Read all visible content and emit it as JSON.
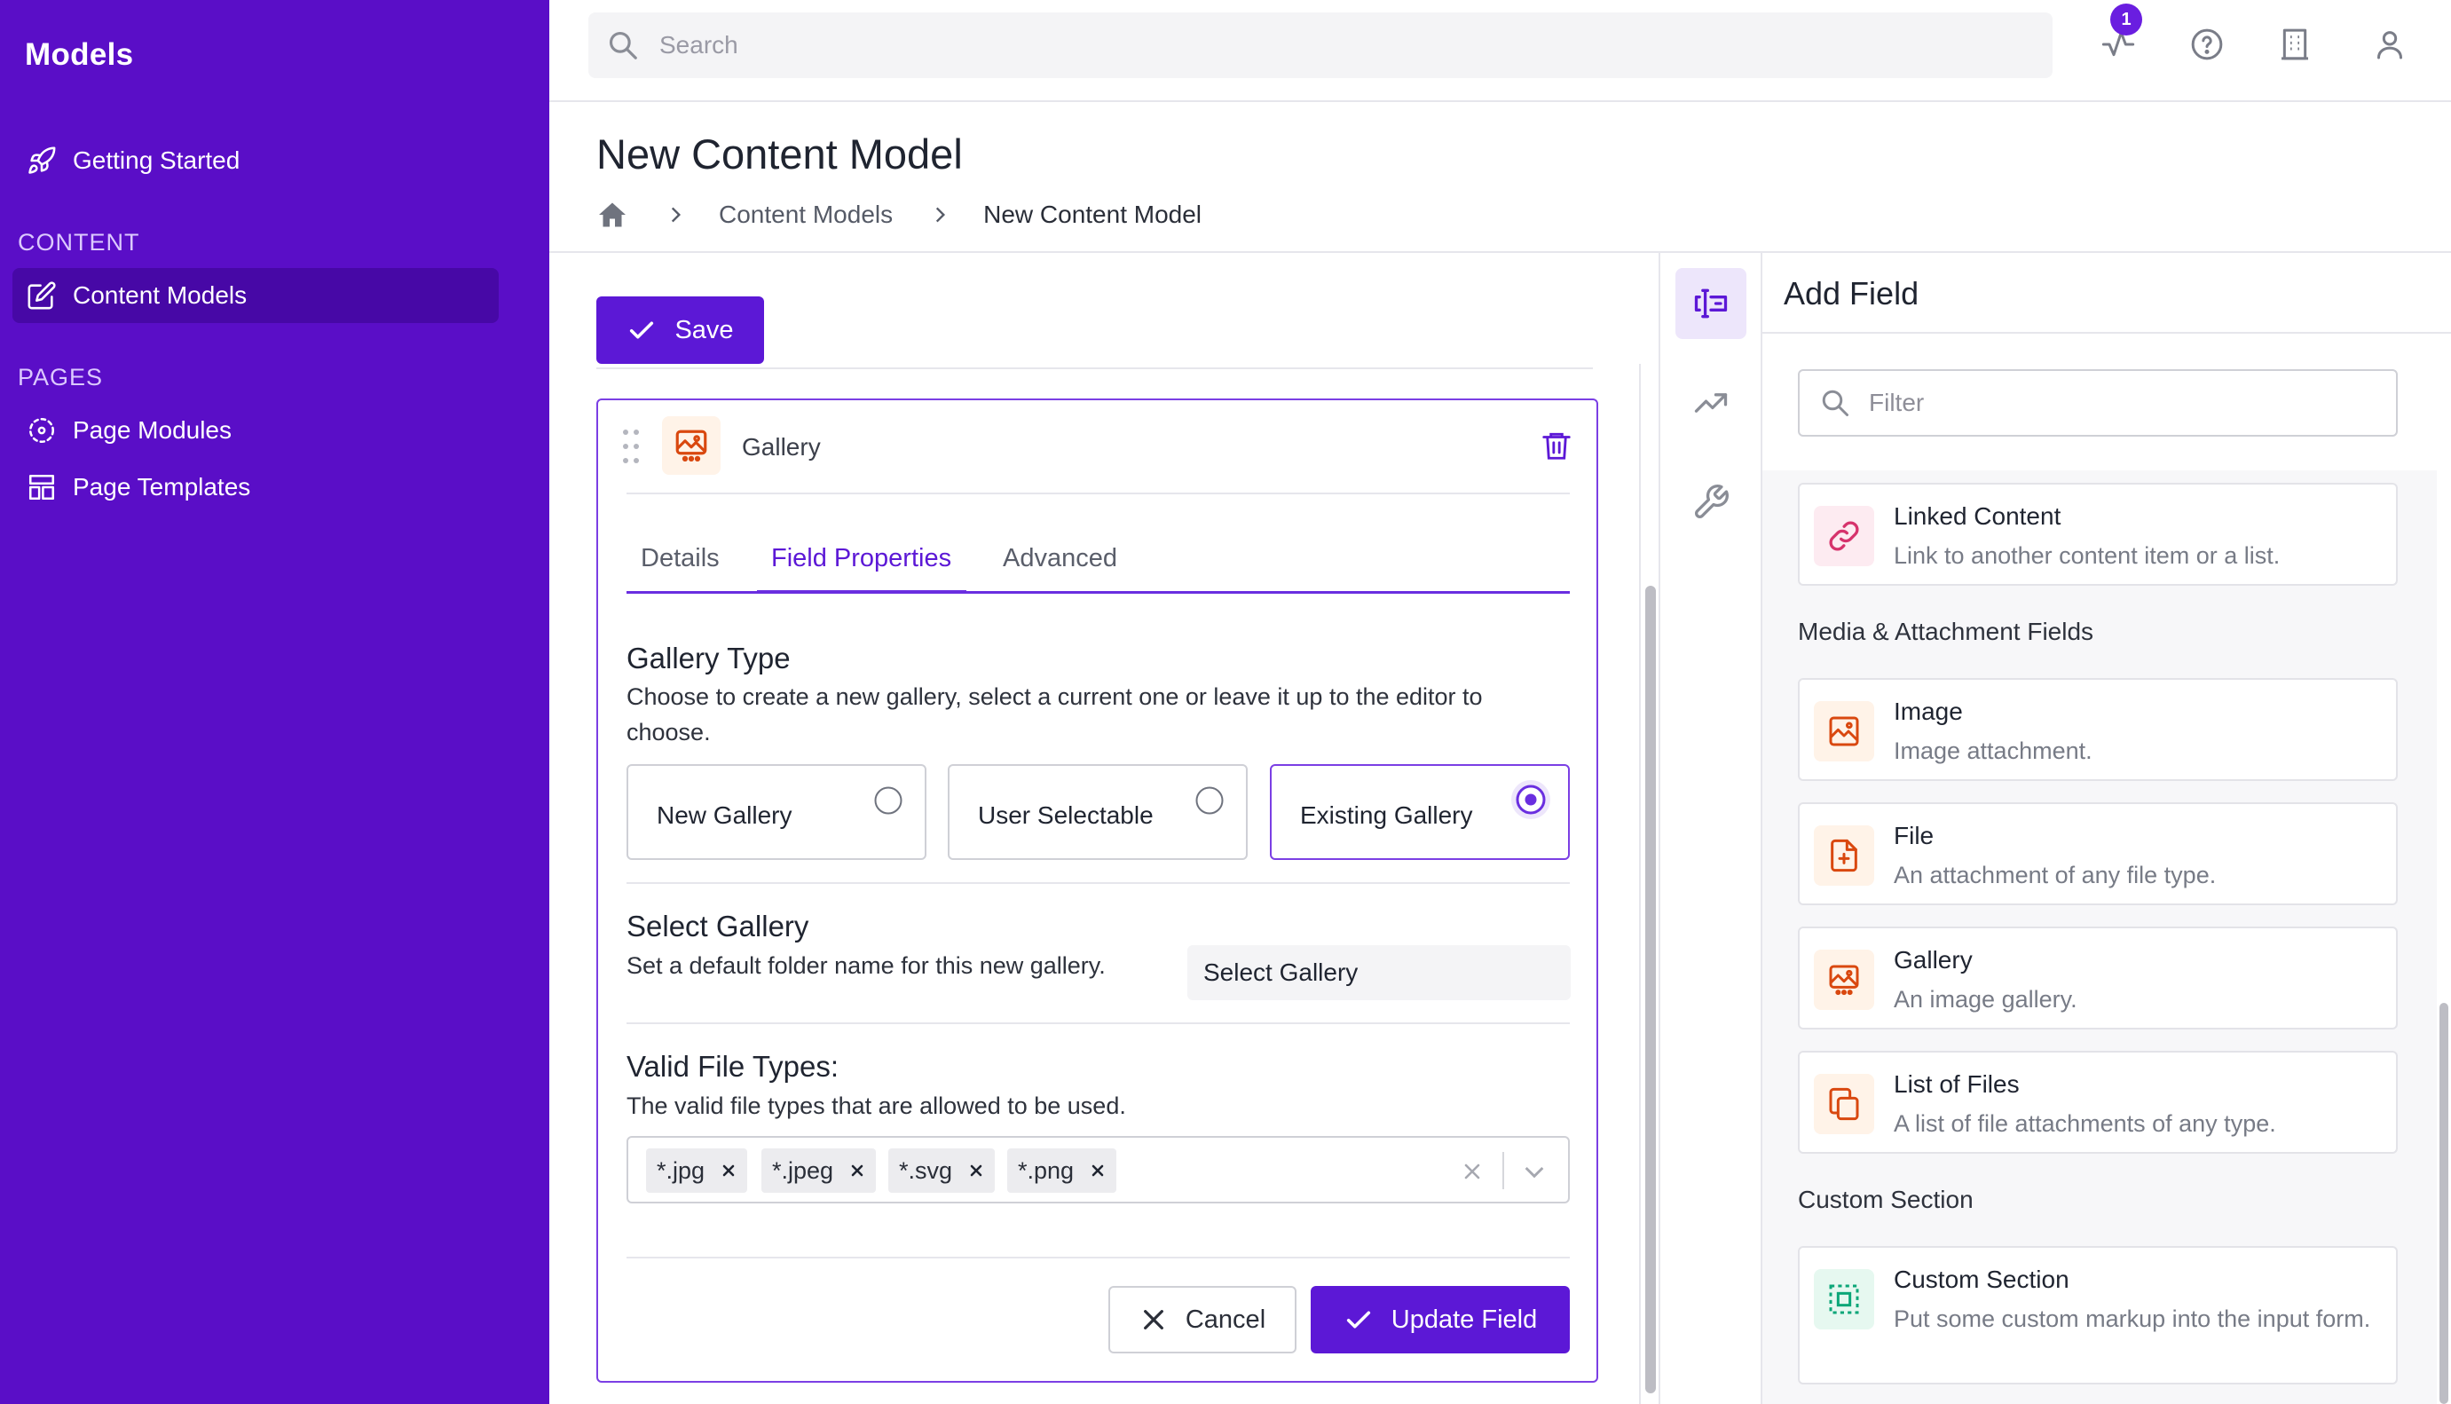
{
  "sidebar": {
    "title": "Models",
    "getting_started": "Getting Started",
    "section_content": "CONTENT",
    "content_models": "Content Models",
    "section_pages": "PAGES",
    "page_modules": "Page Modules",
    "page_templates": "Page Templates"
  },
  "topbar": {
    "search_placeholder": "Search",
    "notification_count": "1"
  },
  "page": {
    "title": "New Content Model",
    "breadcrumb": [
      "Content Models",
      "New Content Model"
    ],
    "save_label": "Save"
  },
  "field": {
    "name": "Gallery",
    "tabs": [
      "Details",
      "Field Properties",
      "Advanced"
    ],
    "active_tab": "Field Properties",
    "gallery_type": {
      "title": "Gallery Type",
      "description": "Choose to create a new gallery, select a current one or leave it up to the editor to choose.",
      "options": [
        "New Gallery",
        "User Selectable",
        "Existing Gallery"
      ],
      "selected": "Existing Gallery"
    },
    "select_gallery": {
      "title": "Select Gallery",
      "description": "Set a default folder name for this new gallery.",
      "value": "Select Gallery"
    },
    "file_types": {
      "title": "Valid File Types:",
      "description": "The valid file types that are allowed to be used.",
      "tags": [
        "*.jpg",
        "*.jpeg",
        "*.svg",
        "*.png"
      ]
    },
    "cancel_label": "Cancel",
    "update_label": "Update Field"
  },
  "add_field": {
    "title": "Add Field",
    "filter_placeholder": "Filter",
    "linked": {
      "name": "Linked Content",
      "desc": "Link to another content item or a list."
    },
    "media_group": "Media & Attachment Fields",
    "image": {
      "name": "Image",
      "desc": "Image attachment."
    },
    "file": {
      "name": "File",
      "desc": "An attachment of any file type."
    },
    "gallery": {
      "name": "Gallery",
      "desc": "An image gallery."
    },
    "list_of_files": {
      "name": "List of Files",
      "desc": "A list of file attachments of any type."
    },
    "custom_group": "Custom Section",
    "custom_section": {
      "name": "Custom Section",
      "desc": "Put some custom markup into the input form."
    }
  },
  "colors": {
    "brand": "#5a0ec7",
    "primary_button": "#5c18d6",
    "media_icon": "#d9480f",
    "link_icon": "#d6336c",
    "custom_icon": "#0ca678"
  }
}
